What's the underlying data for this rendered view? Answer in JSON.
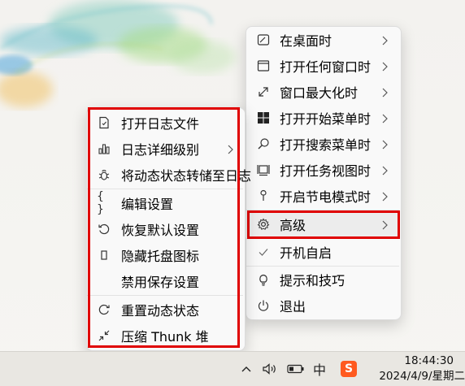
{
  "left_menu": {
    "items": [
      {
        "label": "打开日志文件",
        "icon": "log-file-icon"
      },
      {
        "label": "日志详细级别",
        "icon": "bar-level-icon",
        "submenu": true
      },
      {
        "label": "将动态状态转储至日志",
        "icon": "bug-icon"
      },
      {
        "label": "编辑设置",
        "icon": "braces-icon"
      },
      {
        "label": "恢复默认设置",
        "icon": "restore-icon"
      },
      {
        "label": "隐藏托盘图标",
        "icon": "hide-tray-icon"
      },
      {
        "label": "禁用保存设置",
        "icon": ""
      },
      {
        "label": "重置动态状态",
        "icon": "reset-icon"
      },
      {
        "label": "压缩 Thunk 堆",
        "icon": "compress-icon"
      }
    ]
  },
  "right_menu": {
    "items": [
      {
        "label": "在桌面时",
        "icon": "desktop-icon",
        "submenu": true
      },
      {
        "label": "打开任何窗口时",
        "icon": "window-icon",
        "submenu": true
      },
      {
        "label": "窗口最大化时",
        "icon": "maximize-icon",
        "submenu": true
      },
      {
        "label": "打开开始菜单时",
        "icon": "start-menu-icon",
        "submenu": true
      },
      {
        "label": "打开搜索菜单时",
        "icon": "search-icon",
        "submenu": true
      },
      {
        "label": "打开任务视图时",
        "icon": "task-view-icon",
        "submenu": true
      },
      {
        "label": "开启节电模式时",
        "icon": "power-saver-icon",
        "submenu": true
      },
      {
        "label": "高级",
        "icon": "gear-icon",
        "submenu": true
      },
      {
        "label": "开机自启",
        "icon": "check-icon"
      },
      {
        "label": "提示和技巧",
        "icon": "lightbulb-icon"
      },
      {
        "label": "退出",
        "icon": "power-icon"
      }
    ]
  },
  "taskbar": {
    "overflow_icon": "chevron-up-icon",
    "volume_icon": "speaker-icon",
    "battery_icon": "battery-icon",
    "ime_label": "中",
    "sogou_label": "S",
    "time": "18:44:30",
    "date": "2024/4/9/星期二"
  },
  "colors": {
    "highlight_border": "#e00000",
    "menu_bg": "#f9f9f9",
    "sogou": "#ff5a1f"
  }
}
